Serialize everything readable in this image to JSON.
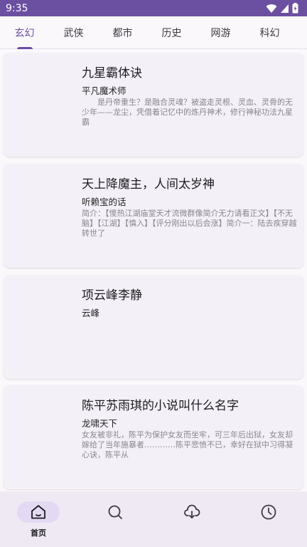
{
  "status": {
    "time": "9:35"
  },
  "tabs": [
    {
      "label": "玄幻",
      "active": true
    },
    {
      "label": "武侠"
    },
    {
      "label": "都市"
    },
    {
      "label": "历史"
    },
    {
      "label": "网游"
    },
    {
      "label": "科幻"
    }
  ],
  "books": [
    {
      "title": "九星霸体诀",
      "author": "平凡魔术师",
      "desc": "　　是丹帝重生？是融合灵魂？被盗走灵根、灵血、灵骨的无少年——龙尘，凭借着记忆中的炼丹神术，修行神秘功法九星霸"
    },
    {
      "title": "天上降魔主，人间太岁神",
      "author": "听赖宝的话",
      "desc": "简介：【惾热江湖庙堂天才流微群像简介无力请看正文】【不无脑】【江湖】【慎入】【评分刚出以后会涨】简介一：陆去疾穿越转世了"
    },
    {
      "title": "项云峰李静",
      "author": "云峰",
      "desc": ""
    },
    {
      "title": "陈平苏雨琪的小说叫什么名字",
      "author": "龙啸天下",
      "desc": "女友被非礼，陈平为保护女友而坐牢，可三年后出狱，女友却嫁给了当年施暴者…………陈平悲愤不已，幸好在狱中习得凝心诀，陈平从"
    }
  ],
  "nav": [
    {
      "label": "首页",
      "icon": "home-icon",
      "active": true
    },
    {
      "label": "",
      "icon": "search-icon"
    },
    {
      "label": "",
      "icon": "download-icon"
    },
    {
      "label": "",
      "icon": "history-icon"
    }
  ],
  "colors": {
    "accent": "#6b4fa0",
    "card": "#f4f0f7",
    "navbar": "#efe9f4"
  }
}
